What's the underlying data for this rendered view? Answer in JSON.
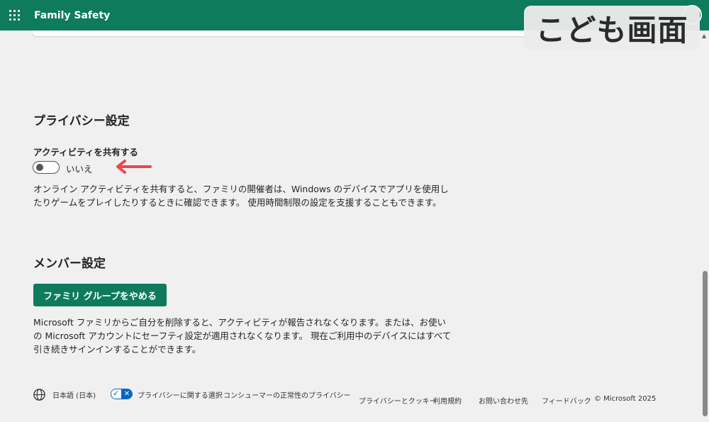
{
  "header": {
    "app_title": "Family Safety",
    "badge": "こども画面"
  },
  "privacy": {
    "heading": "プライバシー設定",
    "share_label": "アクティビティを共有する",
    "toggle_state": "いいえ",
    "description": "オンライン アクティビティを共有すると、ファミリの開催者は、Windows のデバイスでアプリを使用したりゲームをプレイしたりするときに確認できます。 使用時間制限の設定を支援することもできます。"
  },
  "member": {
    "heading": "メンバー設定",
    "leave_button": "ファミリ グループをやめる",
    "description": "Microsoft ファミリからご自分を削除すると、アクティビティが報告されなくなります。または、お使いの Microsoft アカウントにセーフティ設定が適用されなくなります。 現在ご利用中のデバイスにはすべて引き続きサインインすることができます。"
  },
  "footer": {
    "language": "日本語 (日本)",
    "privacy_choices": "プライバシーに関する選択",
    "consumer_health": "コンシューマーの正常性のプライバシー",
    "privacy_cookies": "プライバシーとクッキー",
    "terms": "利用規約",
    "contact": "お問い合わせ先",
    "feedback": "フィードバック",
    "copyright": "© Microsoft 2025"
  },
  "colors": {
    "brand": "#0e7a5e",
    "arrow": "#e8484f",
    "privacy_icon": "#0067c0"
  }
}
